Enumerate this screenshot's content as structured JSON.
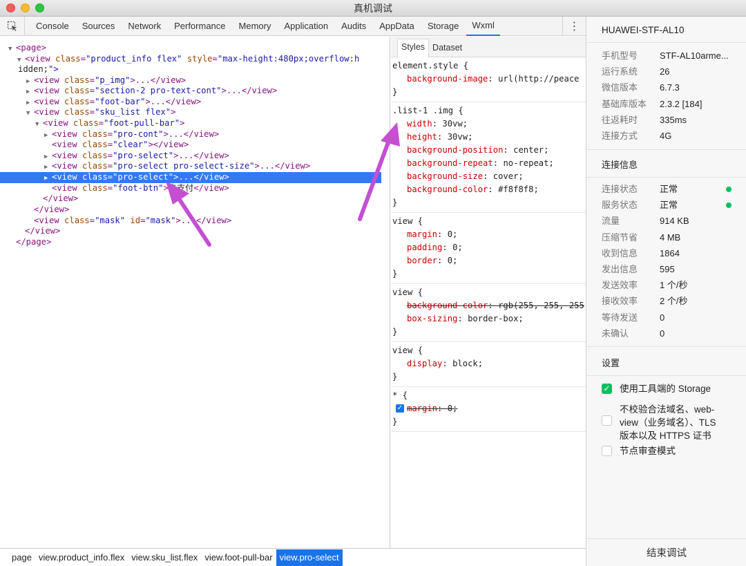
{
  "window": {
    "title": "真机调试"
  },
  "toolbar": {
    "tabs": [
      {
        "label": "Console"
      },
      {
        "label": "Sources"
      },
      {
        "label": "Network"
      },
      {
        "label": "Performance"
      },
      {
        "label": "Memory"
      },
      {
        "label": "Application"
      },
      {
        "label": "Audits"
      },
      {
        "label": "AppData"
      },
      {
        "label": "Storage"
      },
      {
        "label": "Wxml"
      }
    ],
    "active_tab": "Wxml",
    "more_label": "⋮"
  },
  "tree": {
    "lines": [
      {
        "t": "<page>"
      },
      {
        "t": "<view class=\"product_info flex\" style=\"max-height:480px;overflow:h"
      },
      {
        "t": "idden;\">"
      },
      {
        "t": "<view class=\"p_img\">...</view>"
      },
      {
        "t": "<view class=\"section-2 pro-text-cont\">...</view>"
      },
      {
        "t": "<view class=\"foot-bar\">...</view>"
      },
      {
        "t": "<view class=\"sku_list flex\">"
      },
      {
        "t": "<view class=\"foot-pull-bar\">"
      },
      {
        "t": "<view class=\"pro-cont\">...</view>"
      },
      {
        "t": "<view class=\"clear\"></view>"
      },
      {
        "t": "<view class=\"pro-select\">...</view>"
      },
      {
        "t": "<view class=\"pro-select pro-select-size\">...</view>"
      },
      {
        "t": "<view class=\"pro-select\">...</view>"
      },
      {
        "t": "<view class=\"foot-btn\">去支付</view>"
      },
      {
        "t": "</view>"
      },
      {
        "t": "</view>"
      },
      {
        "t": "<view class=\"mask\" id=\"mask\">...</view>"
      },
      {
        "t": "</view>"
      },
      {
        "t": "</page>"
      }
    ]
  },
  "styles": {
    "tabs": [
      "Styles",
      "Dataset"
    ],
    "rules": [
      {
        "selector": "element.style {",
        "props": [
          {
            "name": "background-image",
            "value": "url(http://peace"
          }
        ]
      },
      {
        "selector": ".list-1 .img {",
        "props": [
          {
            "name": "width",
            "value": "30vw;"
          },
          {
            "name": "height",
            "value": "30vw;"
          },
          {
            "name": "background-position",
            "value": "center;"
          },
          {
            "name": "background-repeat",
            "value": "no-repeat;"
          },
          {
            "name": "background-size",
            "value": "cover;"
          },
          {
            "name": "background-color",
            "value": "#f8f8f8;"
          }
        ]
      },
      {
        "selector": "view {",
        "props": [
          {
            "name": "margin",
            "value": "0;"
          },
          {
            "name": "padding",
            "value": "0;"
          },
          {
            "name": "border",
            "value": "0;"
          }
        ]
      },
      {
        "selector": "view {",
        "props": [
          {
            "name": "background-color",
            "value": "rgb(255, 255, 255"
          },
          {
            "name": "box-sizing",
            "value": "border-box;"
          }
        ]
      },
      {
        "selector": "view {",
        "props": [
          {
            "name": "display",
            "value": "block;"
          }
        ]
      },
      {
        "selector": "* {",
        "props": [
          {
            "name": "margin",
            "value": "0;"
          }
        ]
      }
    ],
    "close_brace": "}"
  },
  "breadcrumbs": [
    "page",
    "view.product_info.flex",
    "view.sku_list.flex",
    "view.foot-pull-bar",
    "view.pro-select"
  ],
  "device": {
    "name": "HUAWEI-STF-AL10",
    "info": [
      {
        "k": "手机型号",
        "v": "STF-AL10arme..."
      },
      {
        "k": "运行系统",
        "v": "26"
      },
      {
        "k": "微信版本",
        "v": "6.7.3"
      },
      {
        "k": "基础库版本",
        "v": "2.3.2 [184]"
      },
      {
        "k": "往返耗时",
        "v": "335ms"
      },
      {
        "k": "连接方式",
        "v": "4G"
      }
    ]
  },
  "connection": {
    "title": "连接信息",
    "items": [
      {
        "k": "连接状态",
        "v": "正常"
      },
      {
        "k": "服务状态",
        "v": "正常"
      },
      {
        "k": "流量",
        "v": "914 KB"
      },
      {
        "k": "压缩节省",
        "v": "4 MB"
      },
      {
        "k": "收到信息",
        "v": "1864"
      },
      {
        "k": "发出信息",
        "v": "595"
      },
      {
        "k": "发送效率",
        "v": "1 个/秒"
      },
      {
        "k": "接收效率",
        "v": "2 个/秒"
      },
      {
        "k": "等待发送",
        "v": "0"
      },
      {
        "k": "未确认",
        "v": "0"
      }
    ],
    "status_color": "#07c160"
  },
  "settings": {
    "title": "设置",
    "options": [
      {
        "label": "使用工具端的 Storage",
        "checked": true
      },
      {
        "label_lines": [
          "不校验合法域名、web-",
          "view（业务域名）、TLS",
          "版本以及 HTTPS 证书"
        ],
        "checked": false
      },
      {
        "label": "节点审查模式",
        "checked": false
      }
    ],
    "end_button": "结束调试"
  },
  "annotation_color": "#c44fd1"
}
